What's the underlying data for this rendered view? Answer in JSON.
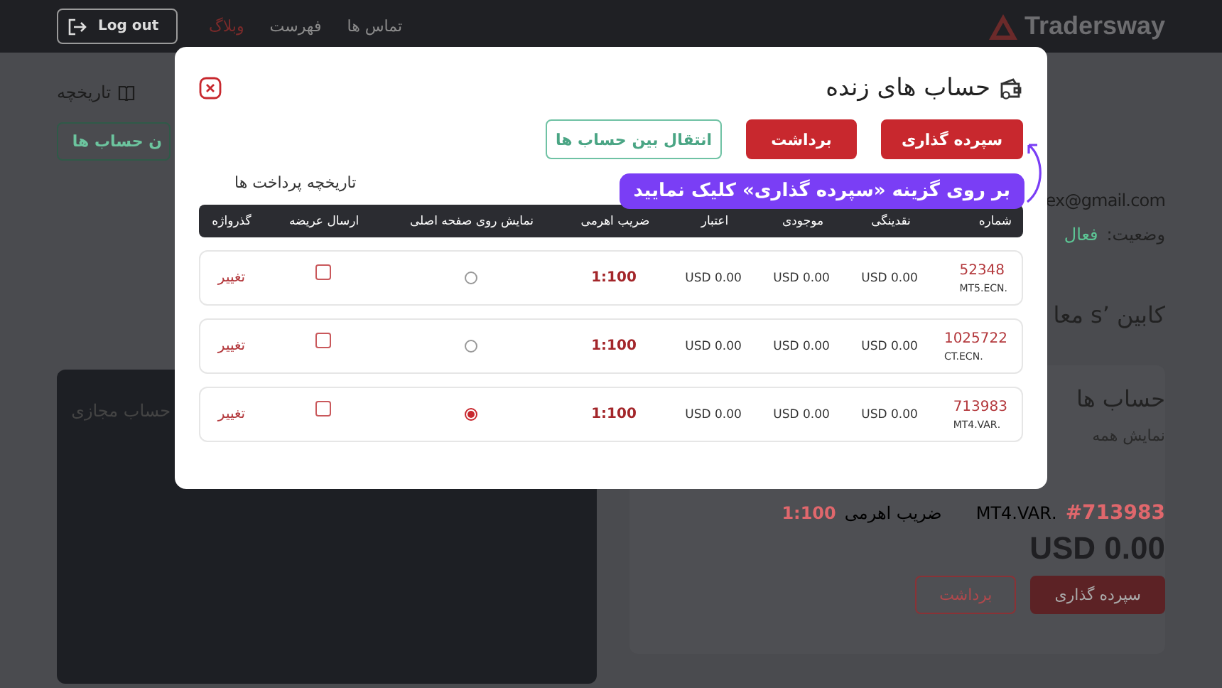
{
  "header": {
    "logo": "Tradersway",
    "logout": "Log out",
    "nav": [
      {
        "label": "تماس ها",
        "selected": false
      },
      {
        "label": "فهرست",
        "selected": false
      },
      {
        "label": "وبلاگ",
        "selected": true
      }
    ]
  },
  "background": {
    "history_link": "تاریخچه",
    "transfer_button": "ن حساب ها",
    "virtual_card": "حساب مجازی",
    "email": "ex@gmail.com",
    "status_label": "وضعیت:",
    "status_value": "فعال",
    "cabin_title": "کابین ’s معا",
    "live_card": {
      "title": "حساب ها",
      "subtitle": "نمایش همه",
      "account_number": "#713983",
      "platform": ".MT4.VAR",
      "leverage_label": "ضریب اهرمی",
      "leverage": "1:100",
      "balance": "USD 0.00",
      "buttons": [
        {
          "label": "سپرده گذاری",
          "kind": "primary"
        },
        {
          "label": "برداشت",
          "kind": "outline"
        }
      ]
    }
  },
  "modal": {
    "title": "حساب های زنده",
    "buttons": [
      {
        "label": "سپرده گذاری",
        "kind": "primary"
      },
      {
        "label": "برداشت",
        "kind": "primary"
      },
      {
        "label": "انتقال بین حساب ها",
        "kind": "outline"
      }
    ],
    "annotation": "بر روی گزینه «سپرده گذاری» کلیک نمایید",
    "history_link": "تاریخچه پرداخت ها",
    "table": {
      "columns": [
        "شماره",
        "نقدینگی",
        "موجودی",
        "اعتبار",
        "ضریب اهرمی",
        "نمایش روی صفحه اصلی",
        "ارسال عریضه",
        "گذرواژه"
      ],
      "rows": [
        {
          "number": "52348",
          "platform": ".MT5.ECN",
          "liquidity": "USD 0.00",
          "balance": "USD 0.00",
          "credit": "USD 0.00",
          "leverage": "1:100",
          "selected": false,
          "checked": false,
          "password": "تغییر"
        },
        {
          "number": "1025722",
          "platform": ".CT.ECN",
          "liquidity": "USD 0.00",
          "balance": "USD 0.00",
          "credit": "USD 0.00",
          "leverage": "1:100",
          "selected": false,
          "checked": false,
          "password": "تغییر"
        },
        {
          "number": "713983",
          "platform": ".MT4.VAR",
          "liquidity": "USD 0.00",
          "balance": "USD 0.00",
          "credit": "USD 0.00",
          "leverage": "1:100",
          "selected": true,
          "checked": false,
          "password": "تغییر"
        }
      ]
    }
  }
}
